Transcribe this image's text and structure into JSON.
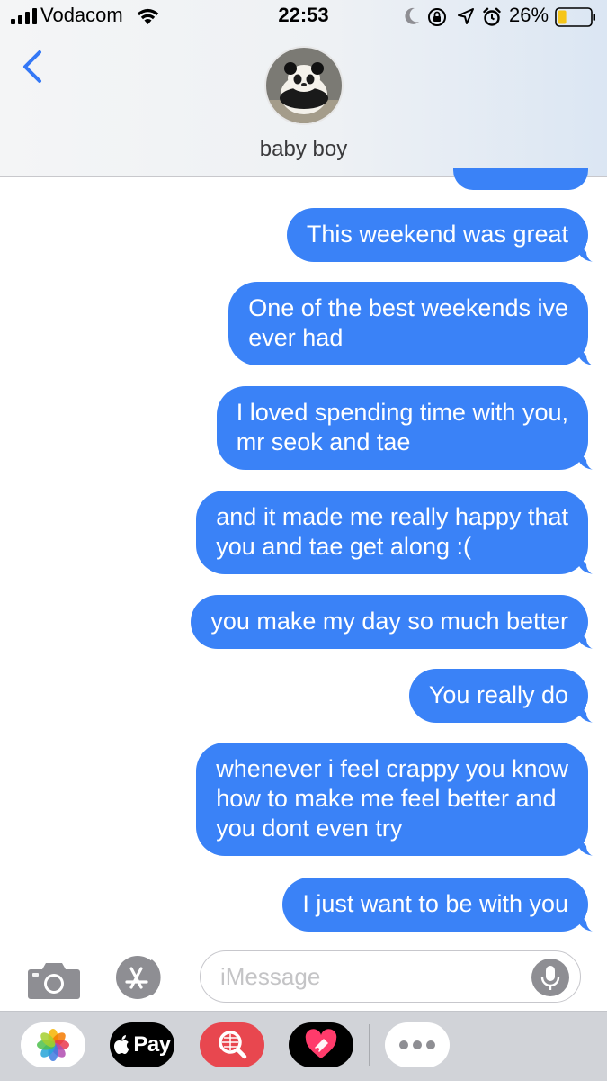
{
  "status_bar": {
    "carrier": "Vodacom",
    "time": "22:53",
    "battery_percent": "26%",
    "signal_bars": 4,
    "battery_level": 0.26,
    "icons": [
      "signal-icon",
      "wifi-icon",
      "moon-icon",
      "rotation-lock-icon",
      "location-arrow-icon",
      "alarm-icon",
      "battery-icon"
    ],
    "battery_color": "#f5c518"
  },
  "header": {
    "contact_name": "baby boy",
    "back_icon": "chevron-left-icon",
    "avatar": "panda-avatar",
    "accent_color": "#3478f6"
  },
  "messages": [
    {
      "text": "This weekend was great",
      "sender": "me"
    },
    {
      "text": "One of the best weekends ive\never had",
      "sender": "me"
    },
    {
      "text": "I loved spending time with you,\nmr seok and tae",
      "sender": "me"
    },
    {
      "text": "and it made me really happy that\nyou and tae get along :(",
      "sender": "me"
    },
    {
      "text": "you make my day so much better",
      "sender": "me"
    },
    {
      "text": "You really do",
      "sender": "me"
    },
    {
      "text": "whenever i feel crappy you know\nhow to make me feel better and\nyou dont even try",
      "sender": "me"
    },
    {
      "text": "I just want to be with you",
      "sender": "me"
    }
  ],
  "bubble_color": "#3a82f7",
  "composer": {
    "placeholder": "iMessage",
    "camera_icon": "camera-icon",
    "apps_icon": "app-store-icon",
    "mic_icon": "microphone-icon"
  },
  "app_drawer": {
    "apps": [
      "photos-icon",
      "apple-pay-icon",
      "image-search-icon",
      "digital-touch-icon",
      "more-icon"
    ],
    "apple_pay_label": "Pay"
  }
}
